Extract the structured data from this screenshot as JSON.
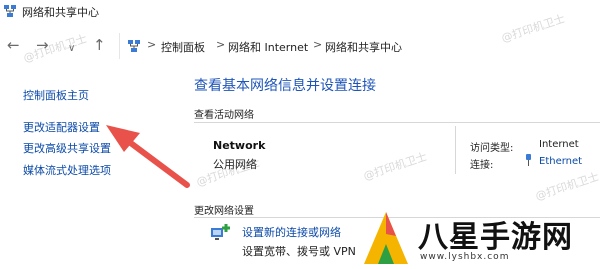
{
  "window": {
    "title": "网络和共享中心"
  },
  "nav": {
    "back_glyph": "←",
    "forward_glyph": "→",
    "dropdown_glyph": "∨",
    "up_glyph": "↑"
  },
  "breadcrumb": {
    "items": [
      "控制面板",
      "网络和 Internet",
      "网络和共享中心"
    ],
    "separator": ">"
  },
  "sidebar": {
    "items": [
      {
        "label": "控制面板主页"
      },
      {
        "label": "更改适配器设置"
      },
      {
        "label": "更改高级共享设置"
      },
      {
        "label": "媒体流式处理选项"
      }
    ]
  },
  "main": {
    "title": "查看基本网络信息并设置连接",
    "active_section": "查看活动网络",
    "network": {
      "name": "Network",
      "category": "公用网络",
      "access_type_label": "访问类型:",
      "access_type_value": "Internet",
      "connection_label": "连接:",
      "connection_value": "Ethernet"
    },
    "change_section": "更改网络设置",
    "tasks": [
      {
        "link": "设置新的连接或网络",
        "description": "设置宽带、拨号或 VPN"
      }
    ]
  },
  "watermark": {
    "text": "@打印机卫士"
  },
  "logo": {
    "text": "八星手游网",
    "url": "www.lyshbx.com"
  },
  "colors": {
    "link": "#0b4aa8",
    "title": "#1f55b8",
    "arrow": "#e8524a"
  }
}
